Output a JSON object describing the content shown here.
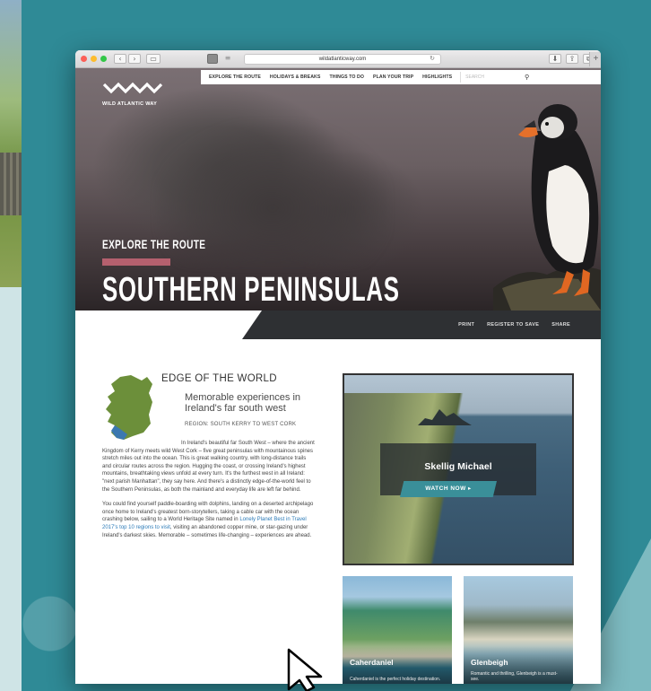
{
  "browser": {
    "url": "wildatlanticway.com",
    "nav_back": "‹",
    "nav_forward": "›"
  },
  "site": {
    "logo_text": "WILD ATLANTIC WAY",
    "logo_sub": "",
    "nav": [
      "EXPLORE THE ROUTE",
      "HOLIDAYS & BREAKS",
      "THINGS TO DO",
      "PLAN YOUR TRIP",
      "HIGHLIGHTS"
    ],
    "search_placeholder": "SEARCH"
  },
  "hero": {
    "kicker": "EXPLORE THE ROUTE",
    "title": "SOUTHERN PENINSULAS",
    "accent_color": "#b5606e"
  },
  "actions": [
    "PRINT",
    "REGISTER TO SAVE",
    "SHARE"
  ],
  "article": {
    "kicker": "EDGE OF THE WORLD",
    "subtitle": "Memorable experiences in Ireland's far south west",
    "region": "REGION: SOUTH KERRY TO WEST CORK",
    "p1": "In Ireland's beautiful far South West – where the ancient Kingdom of Kerry meets wild West Cork – five great peninsulas with mountainous spines stretch miles out into the ocean. This is great walking country, with long-distance trails and circular routes across the region. Hugging the coast, or crossing Ireland's highest mountains, breathtaking views unfold at every turn. It's the furthest west in all Ireland: \"next parish Manhattan\", they say here. And there's a distinctly edge-of-the-world feel to the Southern Peninsulas, as both the mainland and everyday life are left far behind.",
    "p2_before": "You could find yourself paddle-boarding with dolphins, landing on a deserted archipelago once home to Ireland's greatest born-storytellers, taking a cable car with the ocean crashing below, sailing to a World Heritage Site named in ",
    "p2_link": "Lonely Planet Best in Travel 2017's top 10 regions to visit",
    "p2_after": ", visiting an abandoned copper mine, or star-gazing under Ireland's darkest skies. Memorable – sometimes life-changing – experiences are ahead."
  },
  "feature": {
    "title": "Skellig Michael",
    "button": "WATCH NOW ▸"
  },
  "cards": [
    {
      "title": "Caherdaniel",
      "desc": "Caherdaniel is the perfect holiday destination."
    },
    {
      "title": "Glenbeigh",
      "desc": "Romantic and thrilling, Glenbeigh is a must-see."
    }
  ]
}
